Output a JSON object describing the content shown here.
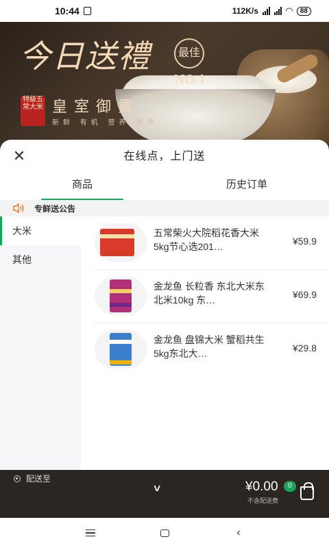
{
  "status_bar": {
    "time": "10:44",
    "network_speed": "112K/s",
    "battery": "88"
  },
  "banner": {
    "title": "今日送禮",
    "badge_best": "最佳",
    "badge_no1": "NO.1",
    "seal_text": "特級五常大米",
    "subtitle": "皇室御貢",
    "tags": "新鲜 有机 营养 健康",
    "active_slide": 0,
    "slide_count": 3
  },
  "sheet": {
    "title": "在线点，上门送",
    "tabs": [
      {
        "label": "商品",
        "active": true
      },
      {
        "label": "历史订单",
        "active": false
      }
    ],
    "notice": "专鲜送公告"
  },
  "categories": [
    {
      "label": "大米",
      "active": true
    },
    {
      "label": "其他",
      "active": false
    }
  ],
  "products": [
    {
      "name": "五常柴火大院稻花香大米5kg节心选201…",
      "price": "¥59.9",
      "package_color": "#d93a2b"
    },
    {
      "name": "金龙鱼 长粒香 东北大米东北米10kg 东…",
      "price": "¥69.9",
      "package_color": "#b0307a"
    },
    {
      "name": "金龙鱼 盘锦大米 蟹稻共生5kg东北大…",
      "price": "¥29.8",
      "package_color": "#3a7fc9"
    }
  ],
  "cart": {
    "deliver_label": "配送至",
    "total": "¥0.00",
    "count": "0",
    "fee_note": "不含配送费"
  },
  "colors": {
    "accent": "#1aa35a",
    "cart_bar": "#2b2622",
    "notice_icon": "#e07a2b"
  }
}
